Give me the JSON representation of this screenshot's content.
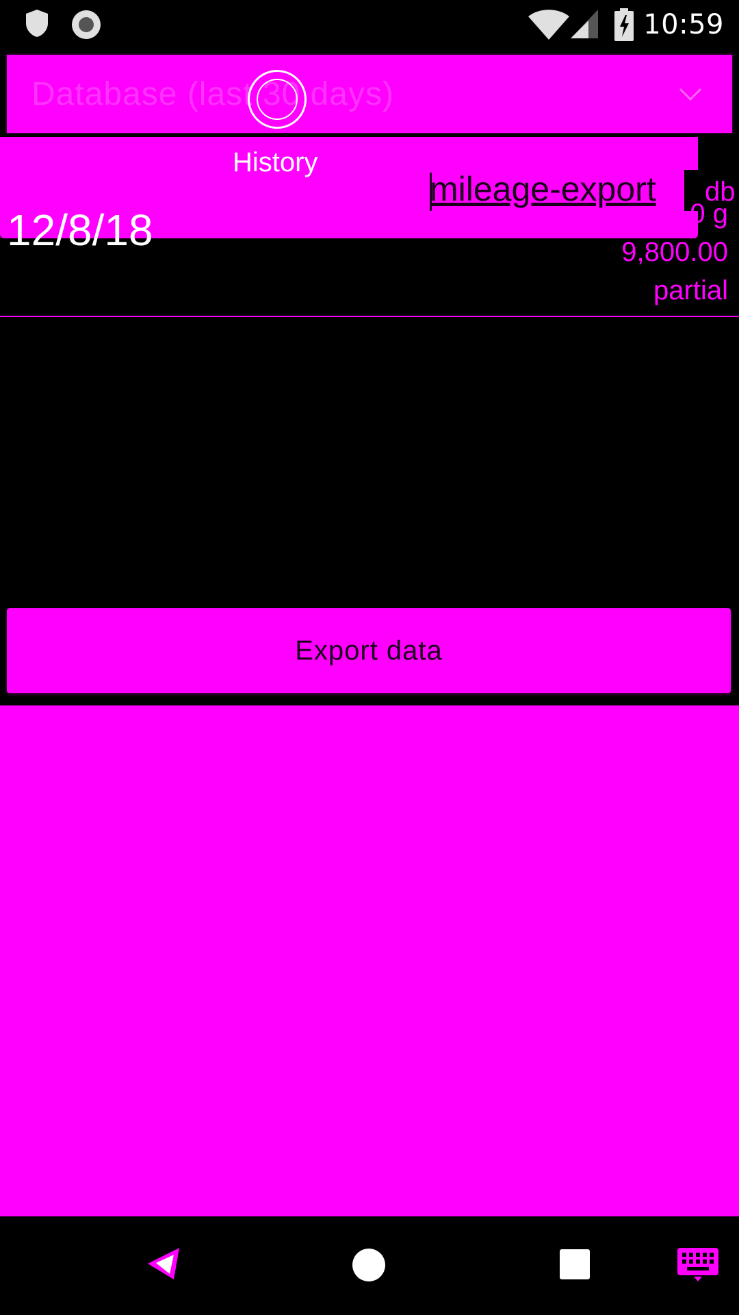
{
  "status_bar": {
    "time": "10:59",
    "icons": [
      "shield-icon",
      "record-icon",
      "wifi-icon",
      "cellular-signal-icon",
      "battery-charging-icon"
    ]
  },
  "dropdown": {
    "label": "Database (last 30 days)",
    "icon": "chevron-down-icon"
  },
  "header": {
    "history_label": "History",
    "file_name": "mileage-export",
    "edge_label": "db"
  },
  "history_row": {
    "date": "12/8/18",
    "amount": "0 g",
    "mileage": "9,800.00",
    "status": "partial"
  },
  "export_button": {
    "label": "Export data"
  },
  "nav_bar": {
    "icons": [
      "back-icon",
      "home-icon",
      "recents-icon",
      "keyboard-icon"
    ]
  },
  "colors": {
    "accent": "#ff00ff",
    "background": "#000000",
    "text_light": "#ffffff",
    "text_dark": "#1a001a"
  }
}
